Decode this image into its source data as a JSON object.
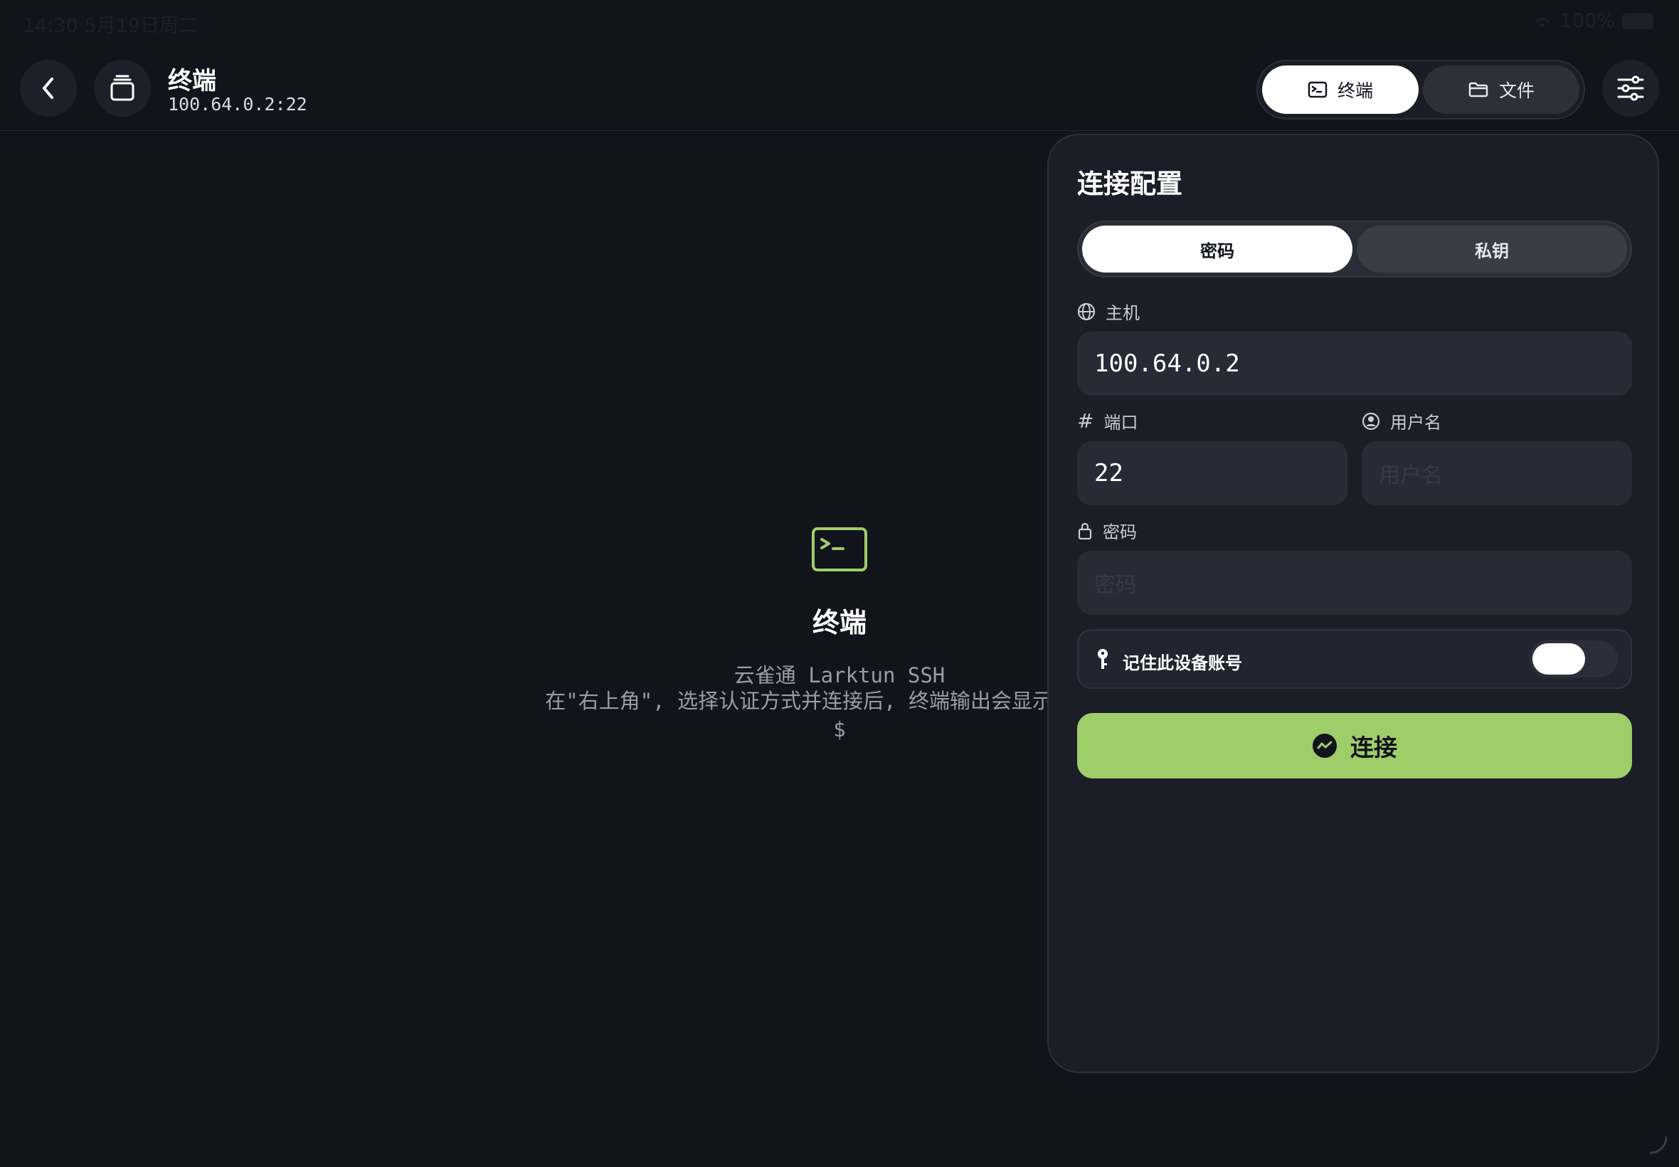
{
  "status_bar": {
    "time_date": "14:30  5月19日周二",
    "battery": "100%"
  },
  "header": {
    "title": "终端",
    "subtitle": "100.64.0.2:22",
    "tabs": [
      {
        "label": "终端",
        "icon": "terminal-icon",
        "active": true
      },
      {
        "label": "文件",
        "icon": "folder-icon",
        "active": false
      }
    ]
  },
  "empty_state": {
    "title": "终端",
    "line1": "云雀通 Larktun SSH",
    "line2": "在\"右上角\", 选择认证方式并连接后, 终端输出会显示",
    "line3": "$",
    "accent": "#9ecd6a"
  },
  "panel": {
    "title": "连接配置",
    "auth_tabs": [
      {
        "label": "密码",
        "active": true
      },
      {
        "label": "私钥",
        "active": false
      }
    ],
    "host": {
      "label": "主机",
      "value": "100.64.0.2"
    },
    "port": {
      "label": "端口",
      "value": "22"
    },
    "username": {
      "label": "用户名",
      "placeholder": "用户名"
    },
    "password": {
      "label": "密码",
      "placeholder": "密码"
    },
    "remember": {
      "label": "记住此设备账号",
      "enabled": false
    },
    "connect": {
      "label": "连接",
      "color": "#9ecd6a"
    }
  }
}
